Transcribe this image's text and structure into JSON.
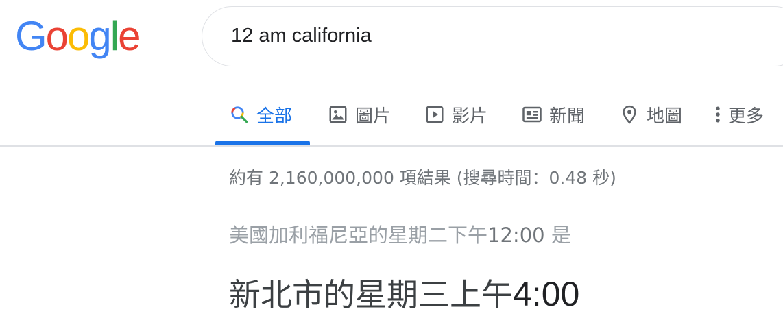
{
  "logo": {
    "letters": [
      {
        "char": "G",
        "color": "#4285F4"
      },
      {
        "char": "o",
        "color": "#EA4335"
      },
      {
        "char": "o",
        "color": "#FBBC05"
      },
      {
        "char": "g",
        "color": "#4285F4"
      },
      {
        "char": "l",
        "color": "#34A853"
      },
      {
        "char": "e",
        "color": "#EA4335"
      }
    ]
  },
  "search": {
    "value": "12 am california"
  },
  "tabs": [
    {
      "label": "全部",
      "icon": "search-icon",
      "active": true
    },
    {
      "label": "圖片",
      "icon": "image-icon",
      "active": false
    },
    {
      "label": "影片",
      "icon": "video-icon",
      "active": false
    },
    {
      "label": "新聞",
      "icon": "news-icon",
      "active": false
    },
    {
      "label": "地圖",
      "icon": "map-pin-icon",
      "active": false
    },
    {
      "label": "更多",
      "icon": "more-vert-icon",
      "active": false
    }
  ],
  "results": {
    "stats": "約有 2,160,000,000 項結果 (搜尋時間：0.48 秒)"
  },
  "conversion": {
    "source_prefix": "美國加利福尼亞的星期二下午",
    "source_time": "12:00",
    "source_suffix": " 是",
    "result_prefix": "新北市的星期三上午",
    "result_time": "4:00"
  },
  "colors": {
    "accent": "#1a73e8",
    "text_secondary": "#70757a"
  }
}
